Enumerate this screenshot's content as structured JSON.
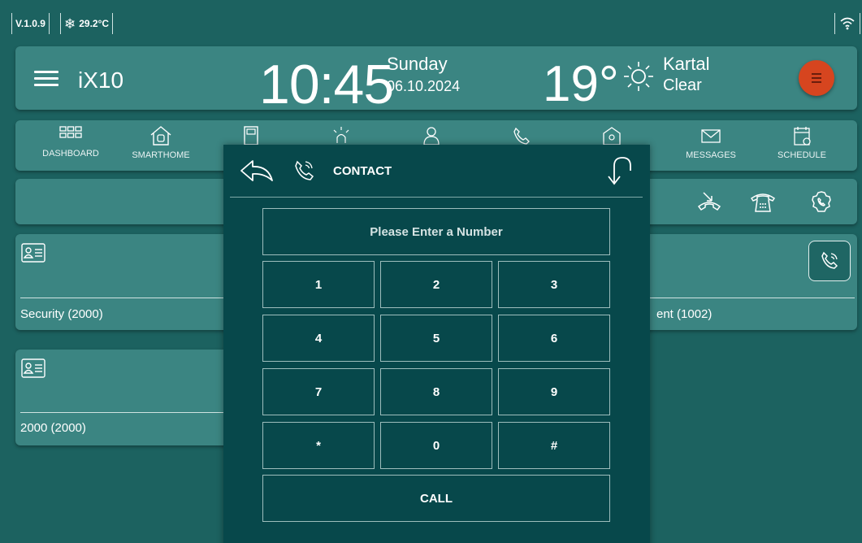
{
  "status": {
    "version": "V.1.0.9",
    "indoor_temp": "29.2°C"
  },
  "header": {
    "brand": "iX10",
    "time": "10:45",
    "day": "Sunday",
    "date": "06.10.2024",
    "temperature": "19°",
    "city": "Kartal",
    "condition": "Clear"
  },
  "nav": {
    "items": [
      {
        "label": "DASHBOARD"
      },
      {
        "label": "SMARTHOME"
      },
      {
        "label": ""
      },
      {
        "label": ""
      },
      {
        "label": ""
      },
      {
        "label": ""
      },
      {
        "label": "..."
      },
      {
        "label": "MESSAGES"
      },
      {
        "label": "SCHEDULE"
      }
    ]
  },
  "contacts": [
    {
      "name": "Security (2000)"
    },
    {
      "name": "ent (1002)"
    },
    {
      "name": "2000 (2000)"
    }
  ],
  "dialer": {
    "title": "CONTACT",
    "placeholder": "Please Enter a Number",
    "keys": [
      "1",
      "2",
      "3",
      "4",
      "5",
      "6",
      "7",
      "8",
      "9",
      "*",
      "0",
      "#"
    ],
    "call_label": "CALL"
  },
  "colors": {
    "background": "#1c6260",
    "card": "#3b8582",
    "dialer": "#07484b",
    "menu_button": "#d6451f"
  }
}
